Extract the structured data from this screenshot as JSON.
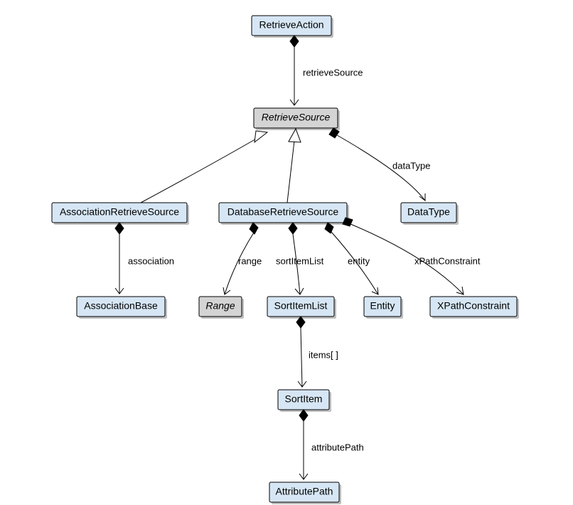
{
  "nodes": {
    "retrieveAction": "RetrieveAction",
    "retrieveSource": "RetrieveSource",
    "associationRetrieveSource": "AssociationRetrieveSource",
    "databaseRetrieveSource": "DatabaseRetrieveSource",
    "dataType": "DataType",
    "associationBase": "AssociationBase",
    "range": "Range",
    "sortItemList": "SortItemList",
    "entity": "Entity",
    "xPathConstraint": "XPathConstraint",
    "sortItem": "SortItem",
    "attributePath": "AttributePath"
  },
  "edges": {
    "retrieveSource": "retrieveSource",
    "dataType": "dataType",
    "association": "association",
    "range": "range",
    "sortItemList": "sortItemList",
    "entity": "entity",
    "xPathConstraint": "xPathConstraint",
    "items": "items[ ]",
    "attributePath": "attributePath"
  }
}
